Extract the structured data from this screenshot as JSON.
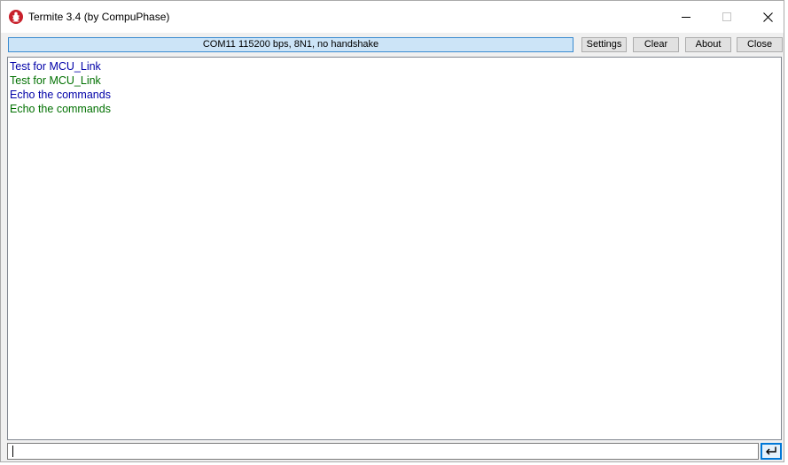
{
  "window": {
    "title": "Termite 3.4 (by CompuPhase)",
    "app_icon": "termite-bug-icon",
    "controls": [
      "minimize-icon",
      "maximize-icon",
      "close-icon"
    ]
  },
  "toolbar": {
    "status": "COM11 115200 bps, 8N1, no handshake",
    "buttons": {
      "settings": "Settings",
      "clear": "Clear",
      "about": "About",
      "close": "Close"
    }
  },
  "terminal": {
    "lines": [
      {
        "text": "Test for MCU_Link",
        "color": "#0000a8"
      },
      {
        "text": "Test for MCU_Link",
        "color": "#007000"
      },
      {
        "text": "Echo the commands",
        "color": "#0000a8"
      },
      {
        "text": "Echo the commands",
        "color": "#007000"
      }
    ]
  },
  "input": {
    "value": "",
    "send_icon": "enter-return-icon"
  },
  "colors": {
    "status_background": "#cce4f7",
    "status_border": "#3a8bd0",
    "sent_text": "#0000a8",
    "received_text": "#007000",
    "accent": "#0078d7"
  }
}
